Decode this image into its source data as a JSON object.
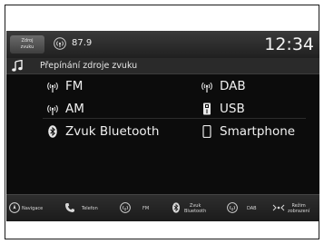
{
  "statusbar": {
    "source_button_line1": "Zdroj",
    "source_button_line2": "zvuku",
    "frequency": "87.9",
    "clock": "12:34"
  },
  "header": {
    "title": "Přepínání zdroje zvuku"
  },
  "sources": {
    "fm": "FM",
    "am": "AM",
    "bluetooth": "Zvuk Bluetooth",
    "dab": "DAB",
    "usb": "USB",
    "smartphone": "Smartphone"
  },
  "navbar": {
    "navigation": "Navigace",
    "phone": "Telefon",
    "fm": "FM",
    "bluetooth_line1": "Zvuk",
    "bluetooth_line2": "Bluetooth",
    "dab": "DAB",
    "display_mode_line1": "Režim",
    "display_mode_line2": "zobrazení"
  },
  "icons": {
    "music": "music-note-icon",
    "radio": "antenna-icon",
    "bluetooth": "bluetooth-icon",
    "usb": "usb-icon",
    "smartphone": "smartphone-icon",
    "navigation": "compass-icon",
    "phone": "phone-icon"
  },
  "colors": {
    "screen_bg": "#0c0c0c",
    "text": "#f0f0f0",
    "bar_bg": "#2a2a2a"
  }
}
